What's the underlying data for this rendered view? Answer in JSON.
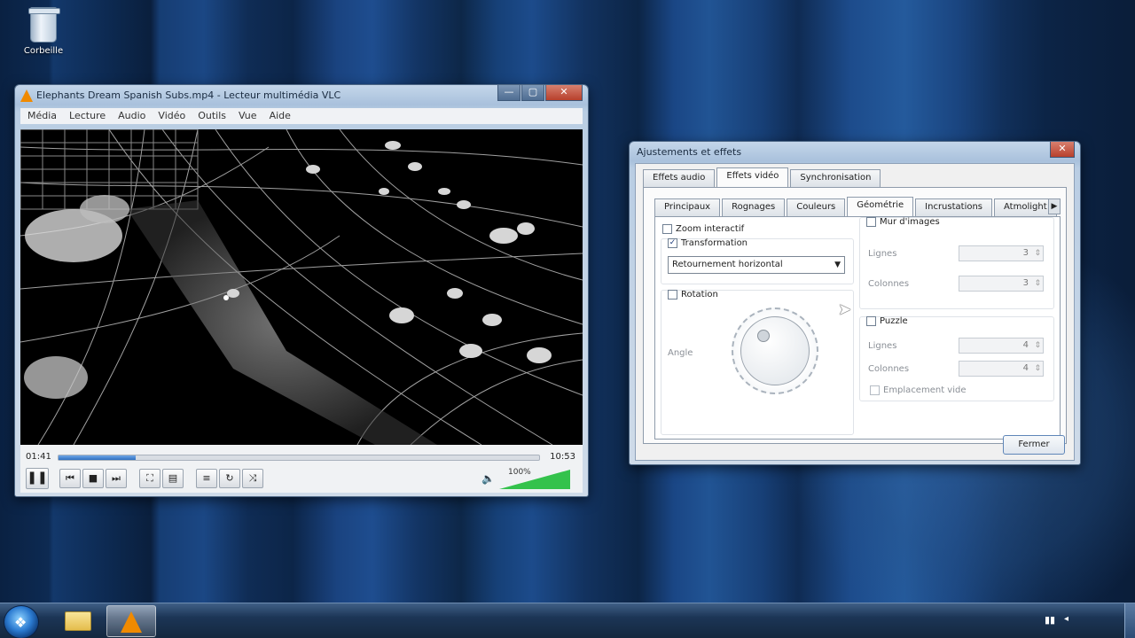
{
  "desktop": {
    "recycle_bin_label": "Corbeille"
  },
  "vlc": {
    "title": "Elephants Dream Spanish Subs.mp4 - Lecteur multimédia VLC",
    "menu": [
      "Média",
      "Lecture",
      "Audio",
      "Vidéo",
      "Outils",
      "Vue",
      "Aide"
    ],
    "time_elapsed": "01:41",
    "time_total": "10:53",
    "progress_fraction": 0.16,
    "volume_label": "100%",
    "volume_fraction": 1.0,
    "buttons": {
      "play_pause": "❚❚",
      "prev": "⏮",
      "stop": "■",
      "next": "⏭",
      "fullscreen": "⛶",
      "playlist_toggle": "▤",
      "ext_settings": "≡",
      "loop": "↻",
      "random": "⤨",
      "volume_icon": "🔈"
    }
  },
  "dialog": {
    "title": "Ajustements et effets",
    "outer_tabs": [
      "Effets audio",
      "Effets vidéo",
      "Synchronisation"
    ],
    "outer_active": 1,
    "inner_tabs": [
      "Principaux",
      "Rognages",
      "Couleurs",
      "Géométrie",
      "Incrustations",
      "Atmolight"
    ],
    "inner_active": 3,
    "zoom_interactive": {
      "label": "Zoom interactif",
      "checked": false
    },
    "transformation": {
      "label": "Transformation",
      "checked": true,
      "selected": "Retournement horizontal"
    },
    "rotation": {
      "label": "Rotation",
      "checked": false,
      "angle_label": "Angle"
    },
    "wall": {
      "label": "Mur d'images",
      "checked": false,
      "rows_label": "Lignes",
      "rows_value": "3",
      "cols_label": "Colonnes",
      "cols_value": "3"
    },
    "puzzle": {
      "label": "Puzzle",
      "checked": false,
      "rows_label": "Lignes",
      "rows_value": "4",
      "cols_label": "Colonnes",
      "cols_value": "4",
      "blackslot_label": "Emplacement vide",
      "blackslot_checked": false
    },
    "close_label": "Fermer"
  },
  "icons": {
    "minimize": "—",
    "maximize": "▢",
    "close": "✕",
    "start": "❖",
    "check": "✓",
    "dropdown": "▼",
    "tab_scroll": "▶",
    "network": "▮▮",
    "tray_volume": "◂"
  }
}
